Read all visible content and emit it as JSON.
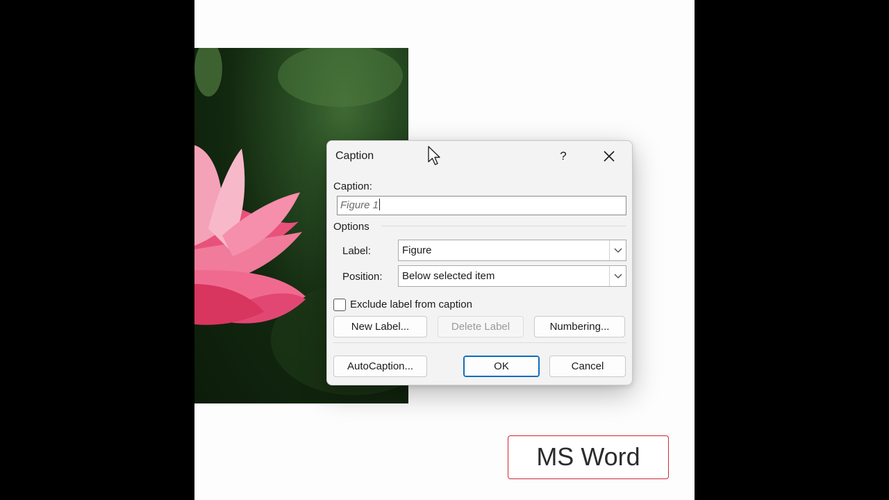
{
  "dialog": {
    "title": "Caption",
    "help_label": "?",
    "caption_label": "Caption:",
    "caption_value": "Figure 1",
    "options_label": "Options",
    "label_label": "Label:",
    "label_value": "Figure",
    "position_label": "Position:",
    "position_value": "Below selected item",
    "exclude_label": "Exclude label from caption",
    "exclude_checked": false,
    "buttons": {
      "new_label": "New Label...",
      "delete_label": "Delete Label",
      "numbering": "Numbering...",
      "autocaption": "AutoCaption...",
      "ok": "OK",
      "cancel": "Cancel"
    }
  },
  "badge": {
    "text": "MS Word"
  },
  "icons": [
    "close-icon",
    "chevron-down-icon",
    "mouse-pointer-icon"
  ],
  "colors": {
    "accent": "#0f6cbd",
    "badge_border": "#cc2a36"
  }
}
